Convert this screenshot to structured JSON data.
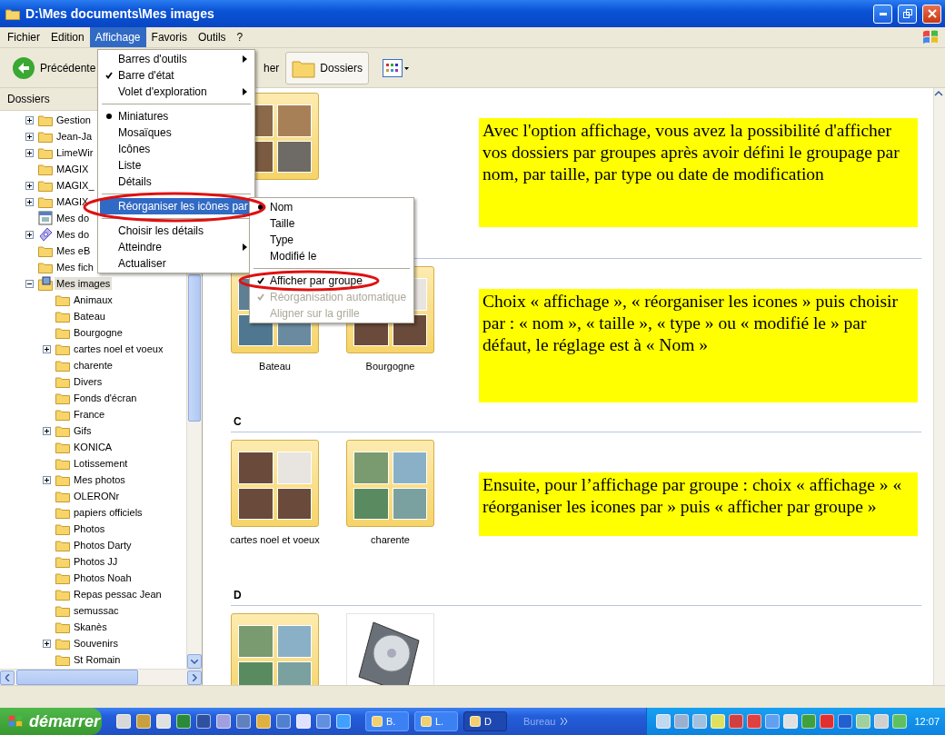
{
  "window": {
    "title": "D:\\Mes documents\\Mes images"
  },
  "menubar": [
    {
      "label": "Fichier",
      "selected": false
    },
    {
      "label": "Edition",
      "selected": false
    },
    {
      "label": "Affichage",
      "selected": true
    },
    {
      "label": "Favoris",
      "selected": false
    },
    {
      "label": "Outils",
      "selected": false
    },
    {
      "label": "?",
      "selected": false
    }
  ],
  "toolbar": {
    "back": "Précédente",
    "search": "her",
    "folders": "Dossiers"
  },
  "folder_pane": {
    "title": "Dossiers",
    "tree": [
      {
        "label": "Gestion",
        "kind": "folder",
        "expanded": false,
        "selected": false
      },
      {
        "label": "Jean-Ja",
        "kind": "folder",
        "expanded": false,
        "selected": false
      },
      {
        "label": "LimeWir",
        "kind": "folder",
        "expanded": false,
        "selected": false
      },
      {
        "label": "MAGIX",
        "kind": "folder",
        "selected": false
      },
      {
        "label": "MAGIX_",
        "kind": "folder",
        "expanded": false,
        "selected": false
      },
      {
        "label": "MAGIX",
        "kind": "folder",
        "expanded": false,
        "selected": false
      },
      {
        "label": "Mes do",
        "kind": "calendar",
        "selected": false
      },
      {
        "label": "Mes do",
        "kind": "disc",
        "expanded": false,
        "selected": false
      },
      {
        "label": "Mes eB",
        "kind": "folder",
        "selected": false
      },
      {
        "label": "Mes fich",
        "kind": "folder",
        "selected": false
      },
      {
        "label": "Mes images",
        "kind": "pictures",
        "expanded": true,
        "selected": true,
        "children": [
          {
            "label": "Animaux",
            "kind": "folder",
            "selected": false
          },
          {
            "label": "Bateau",
            "kind": "folder",
            "selected": false
          },
          {
            "label": "Bourgogne",
            "kind": "folder",
            "selected": false
          },
          {
            "label": "cartes noel et voeux",
            "kind": "folder",
            "expanded": false,
            "selected": false
          },
          {
            "label": "charente",
            "kind": "folder",
            "selected": false
          },
          {
            "label": "Divers",
            "kind": "folder",
            "selected": false
          },
          {
            "label": "Fonds d'écran",
            "kind": "folder",
            "selected": false
          },
          {
            "label": "France",
            "kind": "folder",
            "selected": false
          },
          {
            "label": "Gifs",
            "kind": "folder",
            "expanded": false,
            "selected": false
          },
          {
            "label": "KONICA",
            "kind": "folder",
            "selected": false
          },
          {
            "label": "Lotissement",
            "kind": "folder",
            "selected": false
          },
          {
            "label": "Mes photos",
            "kind": "folder",
            "expanded": false,
            "selected": false
          },
          {
            "label": "OLERONr",
            "kind": "folder",
            "selected": false
          },
          {
            "label": "papiers officiels",
            "kind": "folder",
            "selected": false
          },
          {
            "label": "Photos",
            "kind": "folder",
            "selected": false
          },
          {
            "label": "Photos Darty",
            "kind": "folder",
            "selected": false
          },
          {
            "label": "Photos JJ",
            "kind": "folder",
            "selected": false
          },
          {
            "label": "Photos Noah",
            "kind": "folder",
            "selected": false
          },
          {
            "label": "Repas pessac Jean",
            "kind": "folder",
            "selected": false
          },
          {
            "label": "semussac",
            "kind": "folder",
            "selected": false
          },
          {
            "label": "Skanès",
            "kind": "folder",
            "selected": false
          },
          {
            "label": "Souvenirs",
            "kind": "folder",
            "expanded": false,
            "selected": false
          },
          {
            "label": "St Romain",
            "kind": "folder",
            "selected": false
          }
        ]
      }
    ]
  },
  "content": {
    "groups": [
      {
        "items": [
          {
            "kind": "folder"
          }
        ]
      },
      {
        "items": [
          {
            "kind": "folder",
            "label": "Bateau"
          },
          {
            "kind": "folder",
            "label": "Bourgogne"
          }
        ]
      },
      {
        "header": "C",
        "items": [
          {
            "kind": "folder",
            "label": "cartes noel et voeux"
          },
          {
            "kind": "folder",
            "label": "charente"
          }
        ]
      },
      {
        "header": "D",
        "items": [
          {
            "kind": "folder"
          },
          {
            "kind": "drive"
          }
        ]
      }
    ]
  },
  "view_menu": {
    "sections": [
      {
        "items": [
          {
            "label": "Barres d'outils",
            "submenu": true,
            "highlighted": false
          },
          {
            "label": "Barre d'état",
            "checked": true,
            "submenu": false,
            "highlighted": false
          },
          {
            "label": "Volet d'exploration",
            "submenu": true,
            "highlighted": false
          }
        ]
      },
      {
        "items": [
          {
            "label": "Miniatures",
            "selected": true,
            "submenu": false,
            "highlighted": false
          },
          {
            "label": "Mosaïques",
            "selected": false,
            "submenu": false,
            "highlighted": false
          },
          {
            "label": "Icônes",
            "selected": false,
            "submenu": false,
            "highlighted": false
          },
          {
            "label": "Liste",
            "selected": false,
            "submenu": false,
            "highlighted": false
          },
          {
            "label": "Détails",
            "selected": false,
            "submenu": false,
            "highlighted": false
          }
        ]
      },
      {
        "items": [
          {
            "label": "Réorganiser les icônes par",
            "submenu": true,
            "highlighted": true
          }
        ]
      },
      {
        "items": [
          {
            "label": "Choisir les détails",
            "submenu": false,
            "highlighted": false
          },
          {
            "label": "Atteindre",
            "submenu": true,
            "highlighted": false
          },
          {
            "label": "Actualiser",
            "submenu": false,
            "highlighted": false
          }
        ]
      }
    ]
  },
  "arrange_submenu": {
    "sections": [
      {
        "items": [
          {
            "label": "Nom",
            "selected": true,
            "disabled": false
          },
          {
            "label": "Taille",
            "selected": false,
            "disabled": false
          },
          {
            "label": "Type",
            "selected": false,
            "disabled": false
          },
          {
            "label": "Modifié le",
            "selected": false,
            "disabled": false
          }
        ]
      },
      {
        "items": [
          {
            "label": "Afficher par groupe",
            "checked": true,
            "disabled": false
          },
          {
            "label": "Réorganisation automatique",
            "checked": true,
            "disabled": true
          },
          {
            "label": "Aligner sur la grille",
            "checked": false,
            "disabled": true
          }
        ]
      }
    ]
  },
  "notes": [
    "Avec l'option affichage, vous avez la possibilité d'afficher vos dossiers par groupes après avoir défini le groupage par nom, par taille, par type ou date de modification",
    "Choix « affichage », « réorganiser les icones » puis choisir par : « nom », « taille », « type » ou « modifié le » par défaut, le réglage est à « Nom »",
    "Ensuite, pour l’affichage par groupe : choix « affichage » « réorganiser les icones par » puis « afficher par groupe »"
  ],
  "taskbar": {
    "start": "démarrer",
    "tasks": [
      {
        "label": "B.",
        "selected": false
      },
      {
        "label": "L.",
        "selected": false
      },
      {
        "label": "D",
        "selected": true
      }
    ],
    "toolbar_label": "Bureau",
    "clock": "12:07"
  }
}
